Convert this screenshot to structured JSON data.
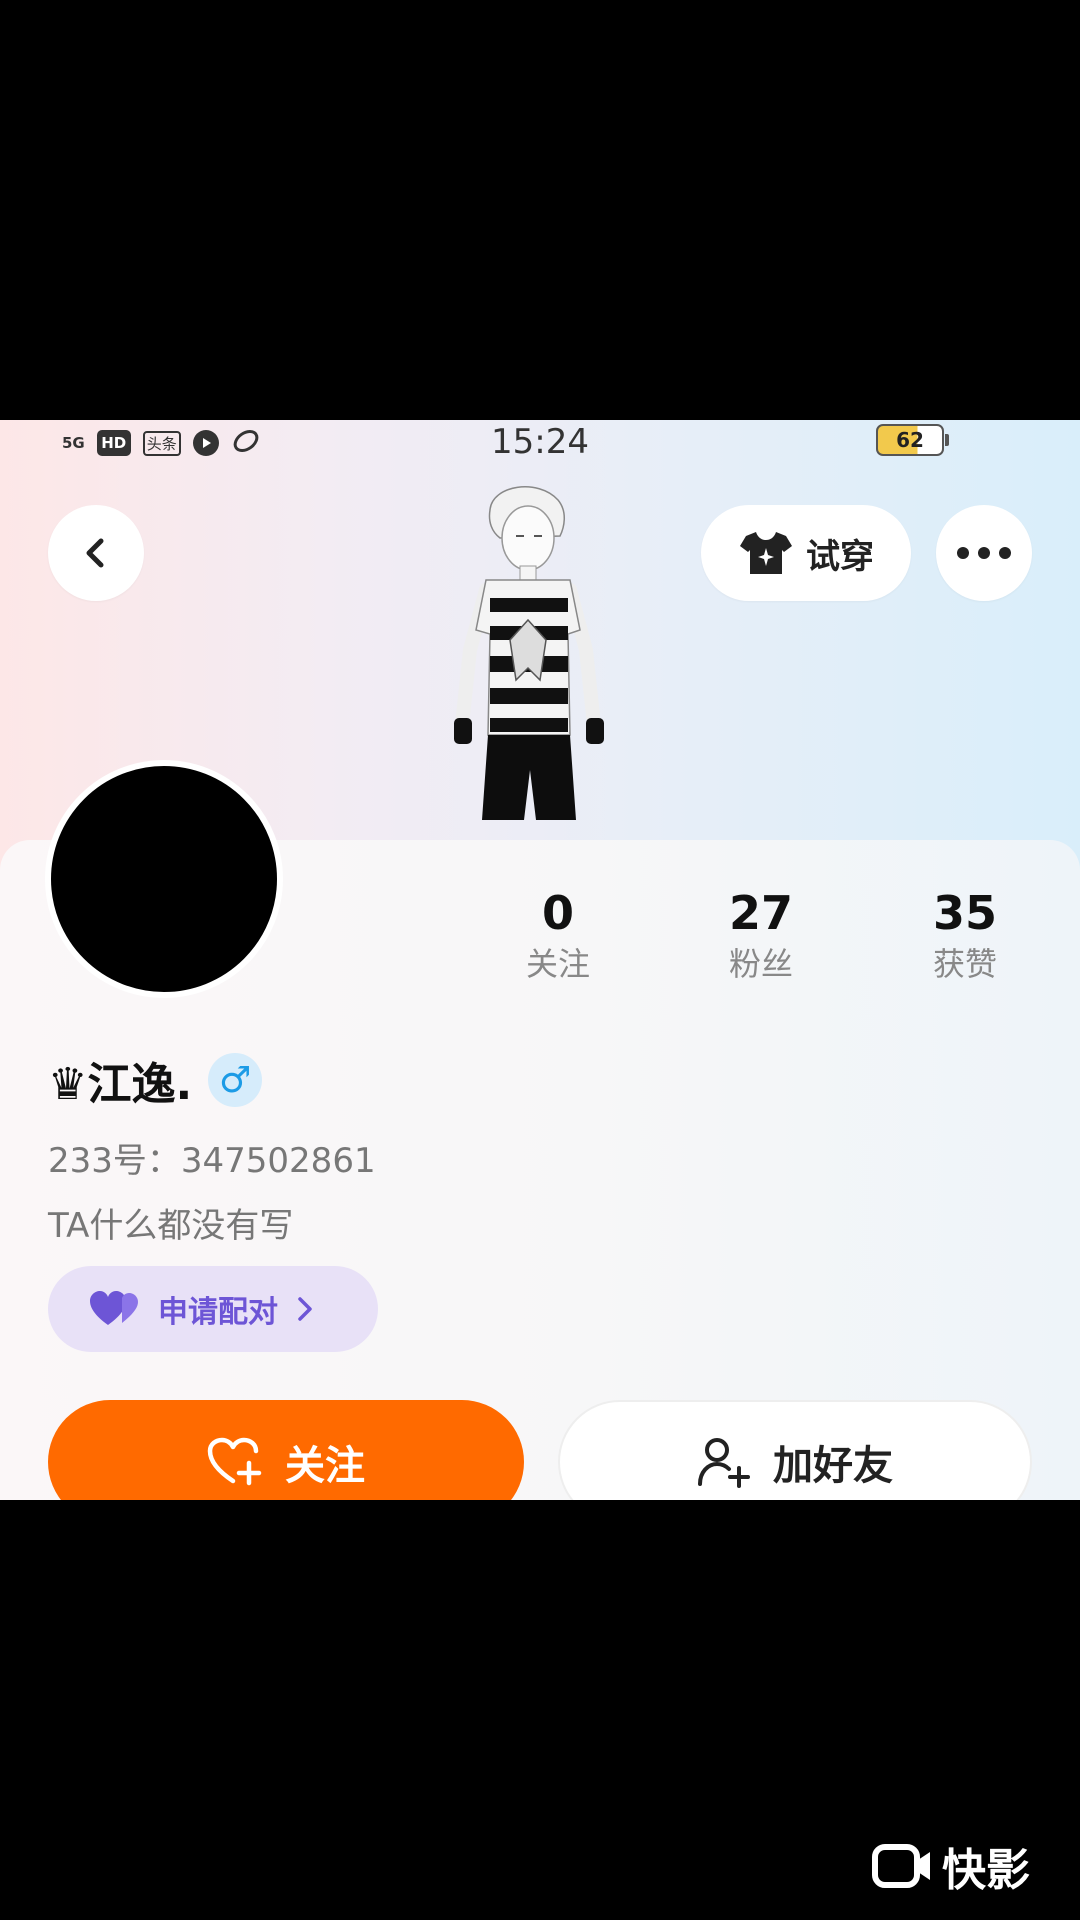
{
  "status_bar": {
    "signal": "5G",
    "hd_badge": "HD",
    "app_badge": "头条",
    "time": "15:24",
    "battery": "62"
  },
  "header": {
    "tryon_label": "试穿",
    "icons": [
      "back-arrow-icon",
      "tshirt-icon",
      "more-dots-icon"
    ]
  },
  "stats": [
    {
      "value": "0",
      "label": "关注"
    },
    {
      "value": "27",
      "label": "粉丝"
    },
    {
      "value": "35",
      "label": "获赞"
    }
  ],
  "profile": {
    "name": "♛江逸.",
    "gender_symbol": "♂",
    "uid": "233号：347502861",
    "bio": "TA什么都没有写",
    "pair_label": "申请配对"
  },
  "actions": {
    "follow_label": "关注",
    "add_friend_label": "加好友"
  },
  "watermark": {
    "label": "快影"
  },
  "colors": {
    "follow_orange": "#ff6a00",
    "pair_purple": "#6d55d6",
    "gender_blue": "#1c9be6"
  }
}
